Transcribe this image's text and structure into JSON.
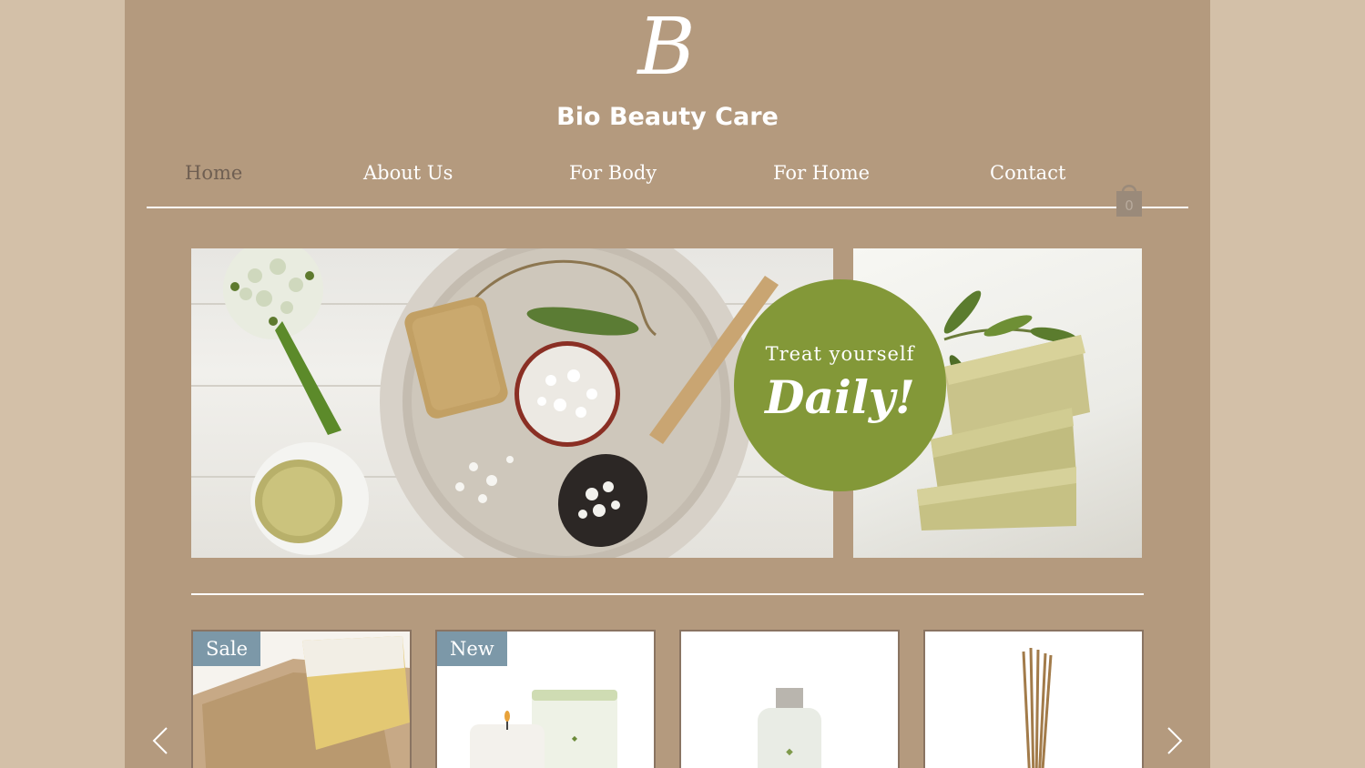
{
  "site": {
    "logo_letter": "B",
    "brand_name": "Bio Beauty Care"
  },
  "nav": {
    "items": [
      {
        "label": "Home",
        "active": true
      },
      {
        "label": "About Us",
        "active": false
      },
      {
        "label": "For Body",
        "active": false
      },
      {
        "label": "For Home",
        "active": false
      },
      {
        "label": "Contact",
        "active": false
      }
    ]
  },
  "cart": {
    "count": "0",
    "icon": "shopping-bag-icon"
  },
  "hero": {
    "badge_line1": "Treat yourself",
    "badge_line2": "Daily!",
    "badge_color": "#839838"
  },
  "products": [
    {
      "ribbon": "Sale",
      "image": "soap-on-sponge"
    },
    {
      "ribbon": "New",
      "image": "candle-and-jar"
    },
    {
      "ribbon": "",
      "image": "glass-bottle"
    },
    {
      "ribbon": "",
      "image": "reed-diffuser"
    }
  ],
  "slider": {
    "prev_icon": "chevron-left-icon",
    "next_icon": "chevron-right-icon"
  },
  "colors": {
    "page_bg": "#b49a7e",
    "outer_bg": "#d3c0a8",
    "ribbon": "#7c98a8",
    "nav_active": "#6f5f52"
  }
}
